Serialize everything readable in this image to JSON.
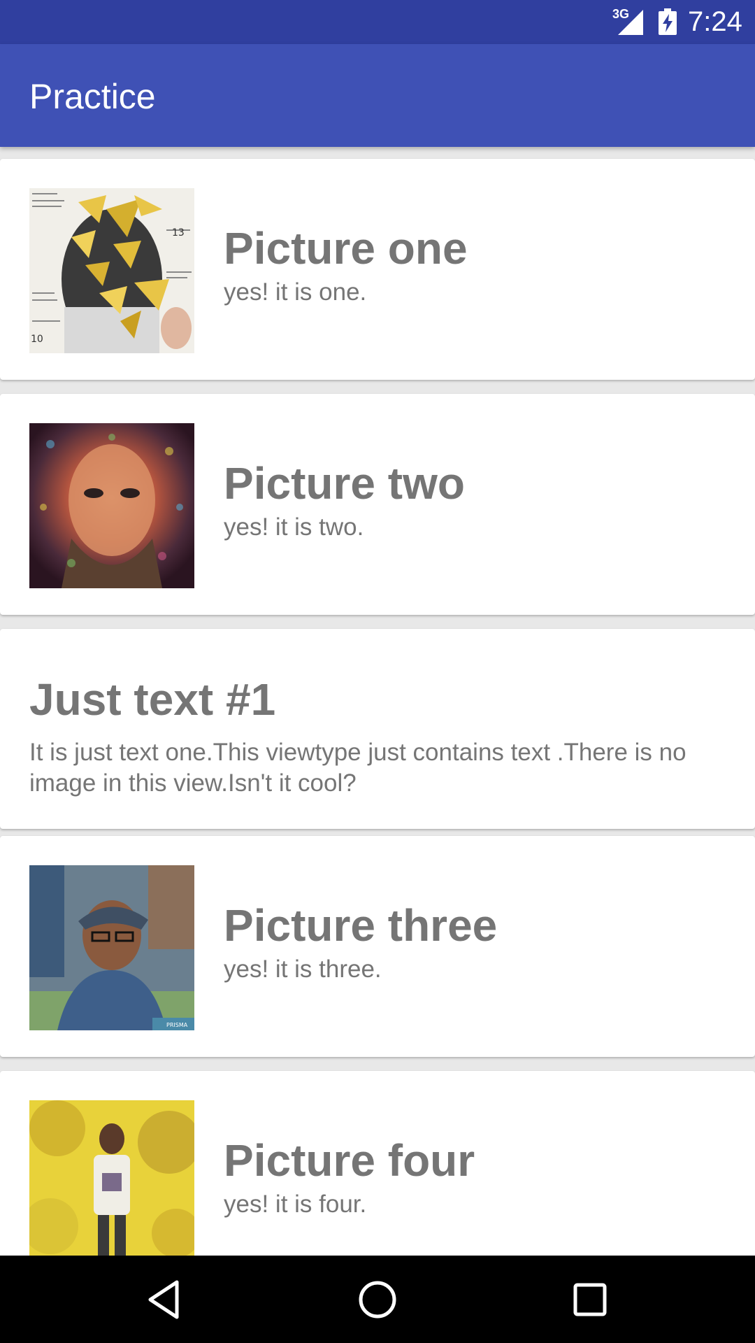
{
  "status_bar": {
    "network_label": "3G",
    "time": "7:24",
    "icons": [
      "cell-signal-icon",
      "battery-charging-icon"
    ]
  },
  "app_bar": {
    "title": "Practice"
  },
  "list": {
    "items": [
      {
        "type": "image",
        "title": "Picture one",
        "subtitle": "yes! it is one.",
        "image": "poster-face-geometric-image"
      },
      {
        "type": "image",
        "title": "Picture two",
        "subtitle": "yes! it is two.",
        "image": "mosaic-portrait-image"
      },
      {
        "type": "text",
        "title": "Just text #1",
        "body": "It is just text one.This viewtype just contains text .There is no image in this view.Isn't it cool?"
      },
      {
        "type": "image",
        "title": "Picture three",
        "subtitle": "yes! it is three.",
        "image": "man-with-cap-photo",
        "watermark": "PRISMA"
      },
      {
        "type": "image",
        "title": "Picture four",
        "subtitle": "yes! it is four.",
        "image": "man-yellow-background-photo"
      }
    ]
  },
  "nav_bar": {
    "icons": [
      "back-icon",
      "home-icon",
      "recents-icon"
    ]
  }
}
